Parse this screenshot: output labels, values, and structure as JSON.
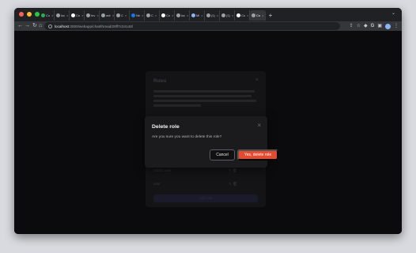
{
  "browser": {
    "window_controls": [
      "close",
      "minimize",
      "maximize"
    ],
    "tabs": [
      {
        "label": "Co",
        "icon": "sheet-icon",
        "color": "#34a853"
      },
      {
        "label": "loc",
        "icon": "globe-icon",
        "color": "#9aa0a6"
      },
      {
        "label": "Co",
        "icon": "github-icon",
        "color": "#ffffff"
      },
      {
        "label": "Inv",
        "icon": "globe-icon",
        "color": "#9aa0a6"
      },
      {
        "label": "adr",
        "icon": "globe-icon",
        "color": "#9aa0a6"
      },
      {
        "label": "C",
        "icon": "globe-icon",
        "color": "#9aa0a6"
      },
      {
        "label": "Ne",
        "icon": "globe-icon",
        "color": "#1a73e8"
      },
      {
        "label": "C",
        "icon": "globe-icon",
        "color": "#9aa0a6"
      },
      {
        "label": "Co",
        "icon": "github-icon",
        "color": "#ffffff"
      },
      {
        "label": "loc",
        "icon": "globe-icon",
        "color": "#9aa0a6"
      },
      {
        "label": "Mi",
        "icon": "globe-icon",
        "color": "#8ab4f8"
      },
      {
        "label": "(1)",
        "icon": "doc-icon",
        "color": "#9aa0a6"
      },
      {
        "label": "(1)",
        "icon": "doc-icon",
        "color": "#9aa0a6"
      },
      {
        "label": "Co",
        "icon": "github-icon",
        "color": "#ffffff"
      },
      {
        "label": "Co",
        "icon": "claude-icon",
        "color": "#9aa0a6",
        "active": true
      }
    ],
    "new_tab_label": "+",
    "tab_menu_label": "⌄",
    "url_host": "localhost",
    "url_path": ":3000/webapp/chat/thread/29ff7c04148/",
    "toolbar_icons": [
      "share-icon",
      "star-icon",
      "extension-icon",
      "google-icon",
      "sidepanel-icon",
      "profile-icon",
      "more-icon"
    ]
  },
  "background": {
    "title": "Roles",
    "close_label": "×",
    "rows": [
      {
        "name": "Admin user",
        "icons": "✎ 🗑"
      },
      {
        "name": "user",
        "icons": "✎ 🗑"
      }
    ],
    "button_label": "Add role"
  },
  "modal": {
    "title": "Delete role",
    "description": "Are you sure you want to delete this role?",
    "cancel_label": "Cancel",
    "confirm_label": "Yes, delete role",
    "close_label": "×"
  },
  "colors": {
    "accent": "#e5492f"
  }
}
